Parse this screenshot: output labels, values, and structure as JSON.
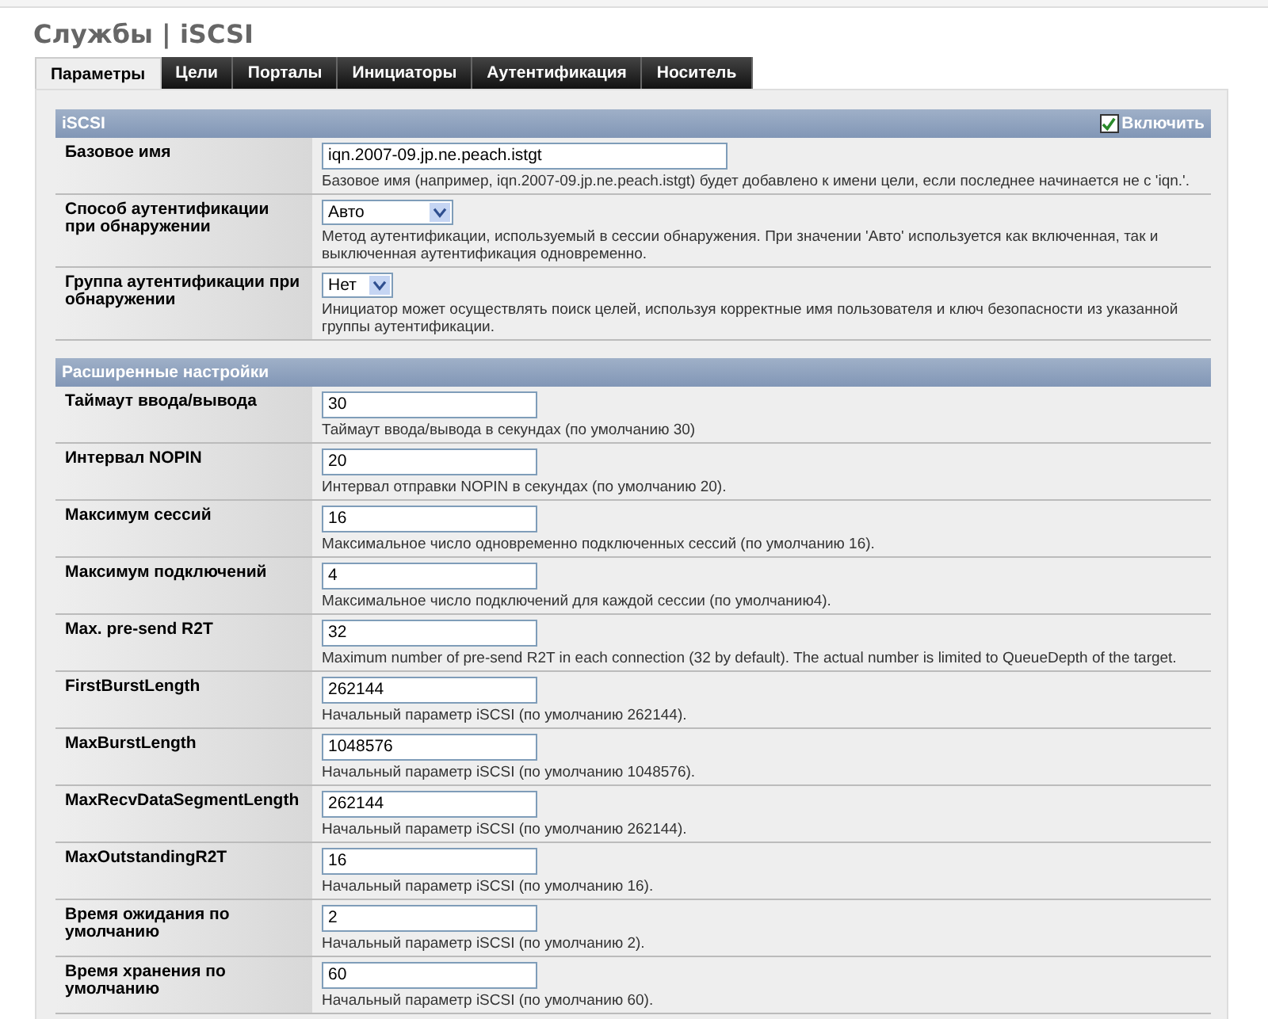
{
  "page_title": "Службы | iSCSI",
  "tabs": [
    {
      "label": "Параметры",
      "selected": true
    },
    {
      "label": "Цели",
      "selected": false
    },
    {
      "label": "Порталы",
      "selected": false
    },
    {
      "label": "Инициаторы",
      "selected": false
    },
    {
      "label": "Аутентификация",
      "selected": false
    },
    {
      "label": "Носитель",
      "selected": false
    }
  ],
  "sections": [
    {
      "title": "iSCSI",
      "enable": {
        "label": "Включить",
        "checked": true
      },
      "rows": [
        {
          "label": "Базовое имя",
          "kind": "text",
          "value": "iqn.2007-09.jp.ne.peach.istgt",
          "wide": true,
          "hint": "Базовое имя (например, iqn.2007-09.jp.ne.peach.istgt) будет добавлено к имени цели, если последнее начинается не с 'iqn.'."
        },
        {
          "label": "Способ аутентификации при обнаружении",
          "kind": "select",
          "value": "Авто",
          "wide": true,
          "hint": "Метод аутентификации, используемый в сессии обнаружения. При значении 'Авто' используется как включенная, так и выключенная аутентификация одновременно."
        },
        {
          "label": "Группа аутентификации при обнаружении",
          "kind": "select",
          "value": "Нет",
          "wide": false,
          "hint": "Инициатор может осуществлять поиск целей, используя корректные имя пользователя и ключ безопасности из указанной группы аутентификации."
        }
      ]
    },
    {
      "title": "Расширенные настройки",
      "rows": [
        {
          "label": "Таймаут ввода/вывода",
          "kind": "text",
          "value": "30",
          "hint": "Таймаут ввода/вывода в секундах (по умолчанию 30)"
        },
        {
          "label": "Интервал NOPIN",
          "kind": "text",
          "value": "20",
          "hint": "Интервал отправки NOPIN в секундах (по умолчанию 20)."
        },
        {
          "label": "Максимум сессий",
          "kind": "text",
          "value": "16",
          "hint": "Максимальное число одновременно подключенных сессий (по умолчанию 16)."
        },
        {
          "label": "Максимум подключений",
          "kind": "text",
          "value": "4",
          "hint": "Максимальное число подключений для каждой сессии (по умолчанию4)."
        },
        {
          "label": "Max. pre-send R2T",
          "kind": "text",
          "value": "32",
          "hint": "Maximum number of pre-send R2T in each connection (32 by default). The actual number is limited to QueueDepth of the target."
        },
        {
          "label": "FirstBurstLength",
          "kind": "text",
          "value": "262144",
          "hint": "Начальный параметр iSCSI (по умолчанию 262144)."
        },
        {
          "label": "MaxBurstLength",
          "kind": "text",
          "value": "1048576",
          "hint": "Начальный параметр iSCSI (по умолчанию 1048576)."
        },
        {
          "label": "MaxRecvDataSegmentLength",
          "kind": "text",
          "value": "262144",
          "hint": "Начальный параметр iSCSI (по умолчанию 262144)."
        },
        {
          "label": "MaxOutstandingR2T",
          "kind": "text",
          "value": "16",
          "hint": "Начальный параметр iSCSI (по умолчанию 16)."
        },
        {
          "label": "Время ожидания по умолчанию",
          "kind": "text",
          "value": "2",
          "hint": "Начальный параметр iSCSI (по умолчанию 2)."
        },
        {
          "label": "Время хранения по умолчанию",
          "kind": "text",
          "value": "60",
          "hint": "Начальный параметр iSCSI (по умолчанию 60)."
        }
      ]
    }
  ]
}
